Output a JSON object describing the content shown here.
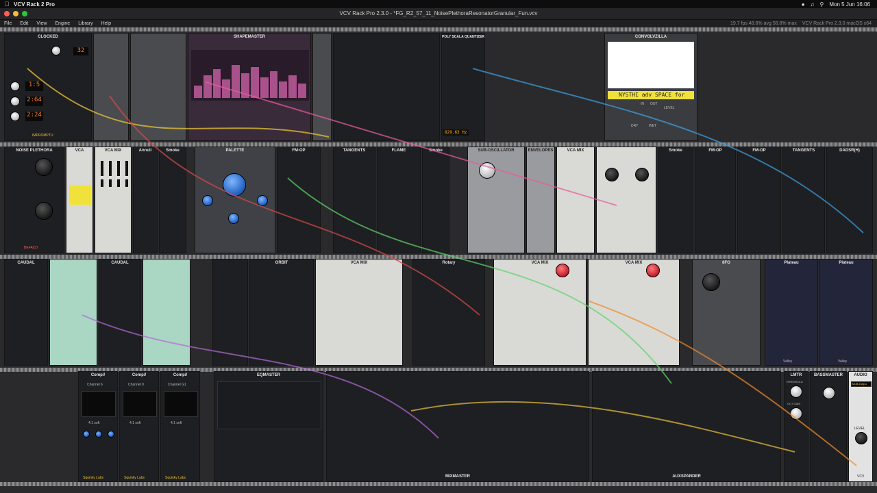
{
  "menubar": {
    "app_name": "VCV Rack 2 Pro",
    "date_time": "Mon 5 Jun  16:06"
  },
  "window": {
    "title": "VCV Rack Pro 2.3.0 - *FG_R2_57_11_NoisePlethoraResonatorGranular_Fun.vcv"
  },
  "app_menu": {
    "items": [
      "File",
      "Edit",
      "View",
      "Engine",
      "Library",
      "Help"
    ],
    "status_fps": "19.7 fps  48.6% avg  58.8% max",
    "status_version": "VCV Rack Pro 2.3.0 macOS x64"
  },
  "modules": {
    "clocked": {
      "title": "CLOCKED",
      "bpm": "32",
      "disp1": "1:5",
      "disp2": "2:64",
      "disp3": "2:24",
      "brand": "IMPROMPTU"
    },
    "shapemaster": {
      "title": "SHAPEMASTER"
    },
    "poly_quantizer": {
      "title": "POLY SCALA QUANTIZER",
      "freq": "829.63 Hz"
    },
    "convolvzilla": {
      "title": "CONVOLVZILLA",
      "ticker": "NYSTHI adv SPACE for",
      "in": "IN",
      "out": "OUT",
      "level": "LEVEL",
      "dry": "DRY",
      "wet": "WET"
    },
    "noise_plethora": {
      "title": "NOISE PLETHORA",
      "brand": "BEFACO"
    },
    "vca": {
      "title": "VCA"
    },
    "vca_mix": {
      "title": "VCA MIX"
    },
    "annuli": {
      "title": "Annuli"
    },
    "smoke": {
      "title": "Smoke"
    },
    "palette": {
      "title": "PALETTE"
    },
    "fm_op": {
      "title": "FM-OP",
      "brand": "BOGAUDIO"
    },
    "tangents": {
      "title": "TANGENTS",
      "subtitle": "steiner-parker filter"
    },
    "flame": {
      "title": "FLAME",
      "subtitle": "analog distortion"
    },
    "sub_osc": {
      "title": "SUB-OSCILLATOR"
    },
    "envelopes": {
      "title": "ENVELOPES"
    },
    "dadsr": {
      "title": "DADSR(H)"
    },
    "caudal": {
      "title": "CAUDAL",
      "subtitle": "mechanical chaos source"
    },
    "orbit": {
      "title": "ORBIT"
    },
    "rotary": {
      "title": "Rotary"
    },
    "eight_fo": {
      "title": "8FO"
    },
    "plateau": {
      "title": "Plateau",
      "brand": "Valley"
    },
    "compi": {
      "title": "Comp//",
      "channels": [
        "Channel 6",
        "Channel 9",
        "Channel G1"
      ],
      "ratio": "4:1 soft",
      "brand": "Squinky Labs"
    },
    "eqmaster": {
      "title": "EQMASTER"
    },
    "mixmaster": {
      "title": "MIXMASTER"
    },
    "auxspander": {
      "title": "AUXSPANDER"
    },
    "lmtr": {
      "title": "LMTR",
      "threshold": "THRESHOLD",
      "out_gain": "OUT GAIN"
    },
    "bassmaster": {
      "title": "BASSMASTER"
    },
    "audio": {
      "title": "AUDIO",
      "device": "Multi-Outpu",
      "level": "LEVEL",
      "brand": "VCV"
    }
  },
  "colors": {
    "accent": "#f0e23a",
    "cable_colors": [
      "#e8c13a",
      "#d14a4a",
      "#3fa0e0",
      "#5ed36a",
      "#b46ad6",
      "#f08a2c",
      "#e65c9e"
    ]
  }
}
